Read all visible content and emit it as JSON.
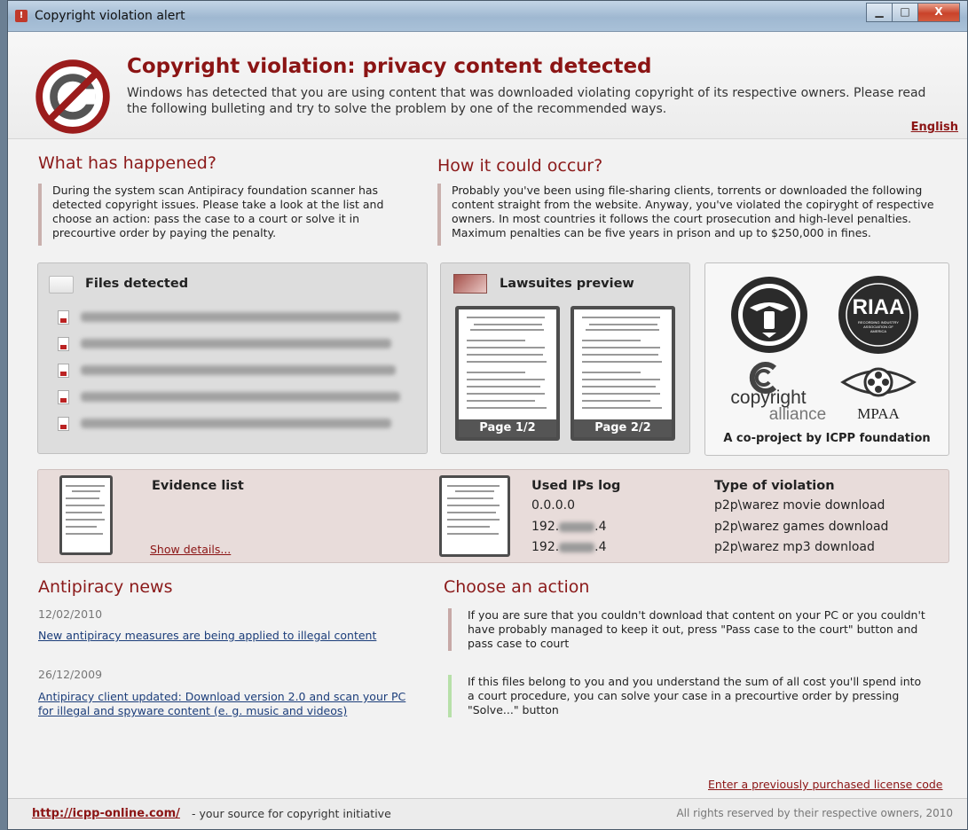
{
  "window": {
    "title": "Copyright violation alert",
    "minimize": "▁",
    "maximize": "□",
    "close": "X"
  },
  "header": {
    "headline": "Copyright violation: privacy content detected",
    "subtext": "Windows has detected that you are using content that was downloaded violating copyright of its respective owners. Please read the following bulleting and try to solve the problem by one of the recommended ways.",
    "language": "English"
  },
  "happened": {
    "title": "What has happened?",
    "text": "During the system scan Antipiracy foundation scanner has detected copyright issues. Please take a look at the list and choose an action: pass the case to a court or solve it in precourtive order by paying the penalty."
  },
  "occur": {
    "title": "How it could occur?",
    "text": "Probably you've been using file-sharing clients, torrents or downloaded the following content straight from the website. Anyway, you've violated the copiryght of respective owners. In most countries it follows the court prosecution and high-level penalties. Maximum penalties can be five years in prison and up to $250,000 in fines."
  },
  "files": {
    "title": "Files detected",
    "rows": 5
  },
  "lawsuits": {
    "title": "Lawsuites preview",
    "pages": [
      "Page 1/2",
      "Page 2/2"
    ]
  },
  "coproject": {
    "riaa": "RIAA",
    "riaa_ring": "RECORDING INDUSTRY ASSOCIATION OF AMERICA",
    "copyright_line1": "copyright",
    "copyright_line2": "alliance",
    "mpaa": "MPAA",
    "caption": "A co-project by ICPP foundation"
  },
  "evidence": {
    "title": "Evidence list",
    "show_details": "Show details...",
    "ips_title": "Used IPs log",
    "ips": [
      {
        "prefix": "0.0.0.0",
        "suffix": ""
      },
      {
        "prefix": "192.",
        "suffix": ".4"
      },
      {
        "prefix": "192.",
        "suffix": ".4"
      }
    ],
    "violation_title": "Type of violation",
    "violations": [
      "p2p\\warez movie download",
      "p2p\\warez games download",
      "p2p\\warez mp3 download"
    ]
  },
  "news": {
    "title": "Antipiracy news",
    "items": [
      {
        "date": "12/02/2010",
        "text": "New antipiracy measures are being applied to illegal content"
      },
      {
        "date": "26/12/2009",
        "text": "Antipiracy client updated: Download version 2.0 and scan your PC for illegal and spyware content (e. g. music and videos)"
      }
    ]
  },
  "actions": {
    "title": "Choose an action",
    "court": "If you are sure that you couldn't download that content on your PC or you couldn't have probably managed to keep it out, press \"Pass case to the court\" button and pass case to court",
    "solve": "If this files belong to you and you understand the sum of all cost you'll spend into a court procedure, you can solve your case in a precourtive order by pressing \"Solve...\" button"
  },
  "license_link": "Enter a previously purchased license code",
  "footer": {
    "url": "http://icpp-online.com/",
    "tagline": " - your source for copyright initiative",
    "rights": "All rights reserved by their respective owners, 2010"
  }
}
